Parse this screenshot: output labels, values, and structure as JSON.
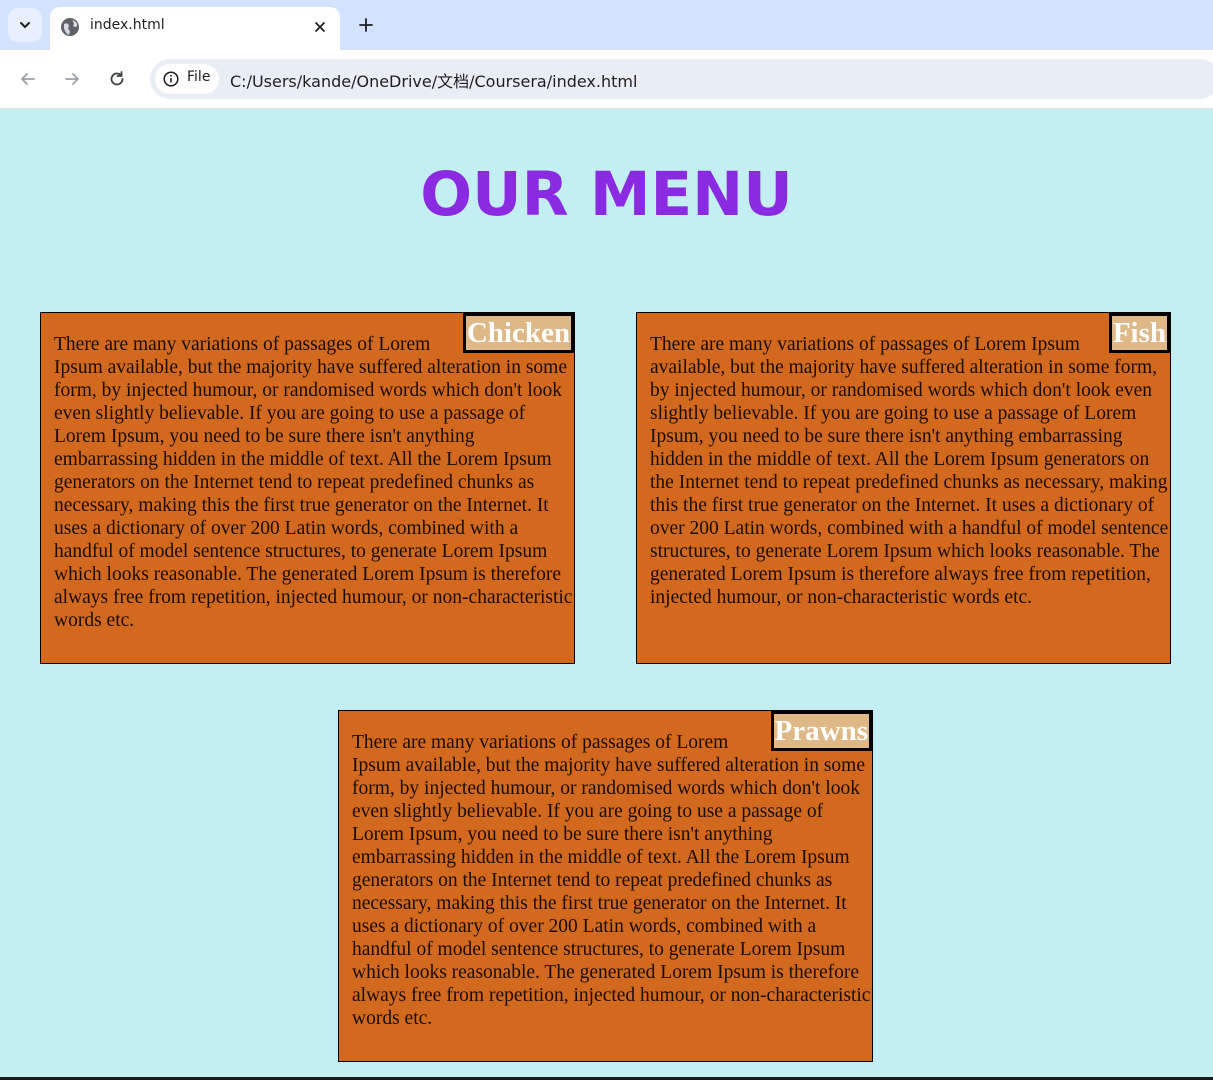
{
  "browser": {
    "tab_title": "index.html",
    "site_info_label": "File",
    "url": "C:/Users/kande/OneDrive/文档/Coursera/index.html"
  },
  "page": {
    "title": "OUR MENU",
    "items": [
      {
        "name": "Chicken",
        "description": "There are many variations of passages of Lorem Ipsum available, but the majority have suffered alteration in some form, by injected humour, or randomised words which don't look even slightly believable. If you are going to use a passage of Lorem Ipsum, you need to be sure there isn't anything embarrassing hidden in the middle of text. All the Lorem Ipsum generators on the Internet tend to repeat predefined chunks as necessary, making this the first true generator on the Internet. It uses a dictionary of over 200 Latin words, combined with a handful of model sentence structures, to generate Lorem Ipsum which looks reasonable. The generated Lorem Ipsum is therefore always free from repetition, injected humour, or non-characteristic words etc."
      },
      {
        "name": "Fish",
        "description": "There are many variations of passages of Lorem Ipsum available, but the majority have suffered alteration in some form, by injected humour, or randomised words which don't look even slightly believable. If you are going to use a passage of Lorem Ipsum, you need to be sure there isn't anything embarrassing hidden in the middle of text. All the Lorem Ipsum generators on the Internet tend to repeat predefined chunks as necessary, making this the first true generator on the Internet. It uses a dictionary of over 200 Latin words, combined with a handful of model sentence structures, to generate Lorem Ipsum which looks reasonable. The generated Lorem Ipsum is therefore always free from repetition, injected humour, or non-characteristic words etc."
      },
      {
        "name": "Prawns",
        "description": "There are many variations of passages of Lorem Ipsum available, but the majority have suffered alteration in some form, by injected humour, or randomised words which don't look even slightly believable. If you are going to use a passage of Lorem Ipsum, you need to be sure there isn't anything embarrassing hidden in the middle of text. All the Lorem Ipsum generators on the Internet tend to repeat predefined chunks as necessary, making this the first true generator on the Internet. It uses a dictionary of over 200 Latin words, combined with a handful of model sentence structures, to generate Lorem Ipsum which looks reasonable. The generated Lorem Ipsum is therefore always free from repetition, injected humour, or non-characteristic words etc."
      }
    ]
  },
  "colors": {
    "page_background": "#c3eff2",
    "title": "#8a2be2",
    "card_background": "#d2691e",
    "label_background": "#deb887"
  },
  "icons": [
    "tab-search-icon",
    "globe-icon",
    "close-icon",
    "plus-icon",
    "back-arrow-icon",
    "forward-arrow-icon",
    "reload-icon",
    "info-icon"
  ]
}
